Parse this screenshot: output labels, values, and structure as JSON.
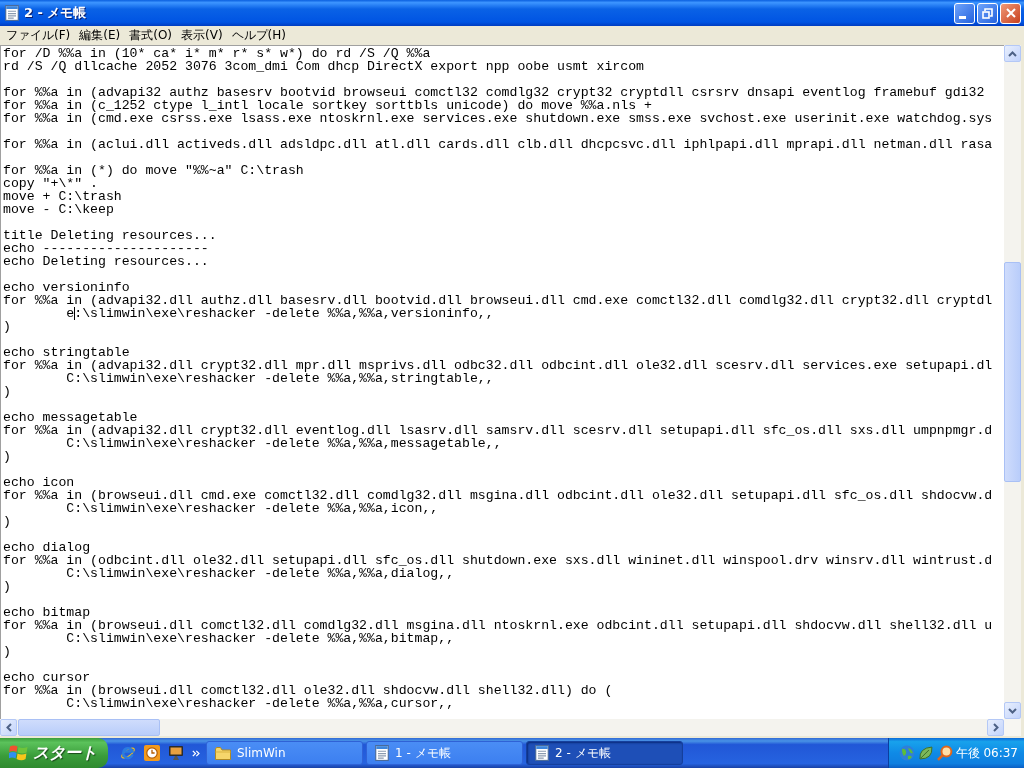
{
  "window": {
    "title": "2 - メモ帳"
  },
  "menu": [
    {
      "label": "ファイル(F)"
    },
    {
      "label": "編集(E)"
    },
    {
      "label": "書式(O)"
    },
    {
      "label": "表示(V)"
    },
    {
      "label": "ヘルプ(H)"
    }
  ],
  "editor": {
    "blocks": [
      {
        "lines": [
          {
            "text": "for /D %%a in (10* ca* i* m* r* s* w*) do rd /S /Q %%a",
            "caret": false
          },
          {
            "text": "rd /S /Q dllcache 2052 3076 3com_dmi Com dhcp DirectX export npp oobe usmt xircom",
            "caret": false
          }
        ]
      },
      {
        "lines": [
          {
            "text": "for %%a in (advapi32 authz basesrv bootvid browseui comctl32 comdlg32 crypt32 cryptdll csrsrv dnsapi eventlog framebuf gdi32",
            "caret": false
          },
          {
            "text": "for %%a in (c_1252 ctype l_intl locale sortkey sorttbls unicode) do move %%a.nls +",
            "caret": false
          },
          {
            "text": "for %%a in (cmd.exe csrss.exe lsass.exe ntoskrnl.exe services.exe shutdown.exe smss.exe svchost.exe userinit.exe watchdog.sys",
            "caret": false
          }
        ]
      },
      {
        "lines": [
          {
            "text": "for %%a in (aclui.dll activeds.dll adsldpc.dll atl.dll cards.dll clb.dll dhcpcsvc.dll iphlpapi.dll mprapi.dll netman.dll rasa",
            "caret": false
          }
        ]
      },
      {
        "lines": [
          {
            "text": "for %%a in (*) do move \"%%~a\" C:\\trash",
            "caret": false
          },
          {
            "text": "copy \"+\\*\" .",
            "caret": false
          },
          {
            "text": "move + C:\\trash",
            "caret": false
          },
          {
            "text": "move - C:\\keep",
            "caret": false
          }
        ]
      },
      {
        "lines": [
          {
            "text": "title Deleting resources...",
            "caret": false
          },
          {
            "text": "echo ---------------------",
            "caret": false
          },
          {
            "text": "echo Deleting resources...",
            "caret": false
          }
        ]
      },
      {
        "lines": [
          {
            "text": "echo versioninfo",
            "caret": false
          },
          {
            "text": "for %%a in (advapi32.dll authz.dll basesrv.dll bootvid.dll browseui.dll cmd.exe comctl32.dll comdlg32.dll crypt32.dll cryptdl",
            "caret": false
          },
          {
            "text": "        e:\\slimwin\\exe\\reshacker -delete %%a,%%a,versioninfo,,",
            "caret": true
          },
          {
            "text": ")",
            "caret": false
          }
        ]
      },
      {
        "lines": [
          {
            "text": "echo stringtable",
            "caret": false
          },
          {
            "text": "for %%a in (advapi32.dll crypt32.dll mpr.dll msprivs.dll odbc32.dll odbcint.dll ole32.dll scesrv.dll services.exe setupapi.dl",
            "caret": false
          },
          {
            "text": "        C:\\slimwin\\exe\\reshacker -delete %%a,%%a,stringtable,,",
            "caret": false
          },
          {
            "text": ")",
            "caret": false
          }
        ]
      },
      {
        "lines": [
          {
            "text": "echo messagetable",
            "caret": false
          },
          {
            "text": "for %%a in (advapi32.dll crypt32.dll eventlog.dll lsasrv.dll samsrv.dll scesrv.dll setupapi.dll sfc_os.dll sxs.dll umpnpmgr.d",
            "caret": false
          },
          {
            "text": "        C:\\slimwin\\exe\\reshacker -delete %%a,%%a,messagetable,,",
            "caret": false
          },
          {
            "text": ")",
            "caret": false
          }
        ]
      },
      {
        "lines": [
          {
            "text": "echo icon",
            "caret": false
          },
          {
            "text": "for %%a in (browseui.dll cmd.exe comctl32.dll comdlg32.dll msgina.dll odbcint.dll ole32.dll setupapi.dll sfc_os.dll shdocvw.d",
            "caret": false
          },
          {
            "text": "        C:\\slimwin\\exe\\reshacker -delete %%a,%%a,icon,,",
            "caret": false
          },
          {
            "text": ")",
            "caret": false
          }
        ]
      },
      {
        "lines": [
          {
            "text": "echo dialog",
            "caret": false
          },
          {
            "text": "for %%a in (odbcint.dll ole32.dll setupapi.dll sfc_os.dll shutdown.exe sxs.dll wininet.dll winspool.drv winsrv.dll wintrust.d",
            "caret": false
          },
          {
            "text": "        C:\\slimwin\\exe\\reshacker -delete %%a,%%a,dialog,,",
            "caret": false
          },
          {
            "text": ")",
            "caret": false
          }
        ]
      },
      {
        "lines": [
          {
            "text": "echo bitmap",
            "caret": false
          },
          {
            "text": "for %%a in (browseui.dll comctl32.dll comdlg32.dll msgina.dll ntoskrnl.exe odbcint.dll setupapi.dll shdocvw.dll shell32.dll u",
            "caret": false
          },
          {
            "text": "        C:\\slimwin\\exe\\reshacker -delete %%a,%%a,bitmap,,",
            "caret": false
          },
          {
            "text": ")",
            "caret": false
          }
        ]
      },
      {
        "lines": [
          {
            "text": "echo cursor",
            "caret": false
          },
          {
            "text": "for %%a in (browseui.dll comctl32.dll ole32.dll shdocvw.dll shell32.dll) do (",
            "caret": false
          },
          {
            "text": "        C:\\slimwin\\exe\\reshacker -delete %%a,%%a,cursor,,",
            "caret": false
          }
        ]
      }
    ]
  },
  "taskbar": {
    "start": "スタート",
    "tasks": [
      {
        "label": "SlimWin",
        "kind": "folder",
        "selected": false
      },
      {
        "label": "1 - メモ帳",
        "kind": "notepad",
        "selected": false
      },
      {
        "label": "2 - メモ帳",
        "kind": "notepad",
        "selected": true
      }
    ],
    "clock": "午後 06:37"
  }
}
